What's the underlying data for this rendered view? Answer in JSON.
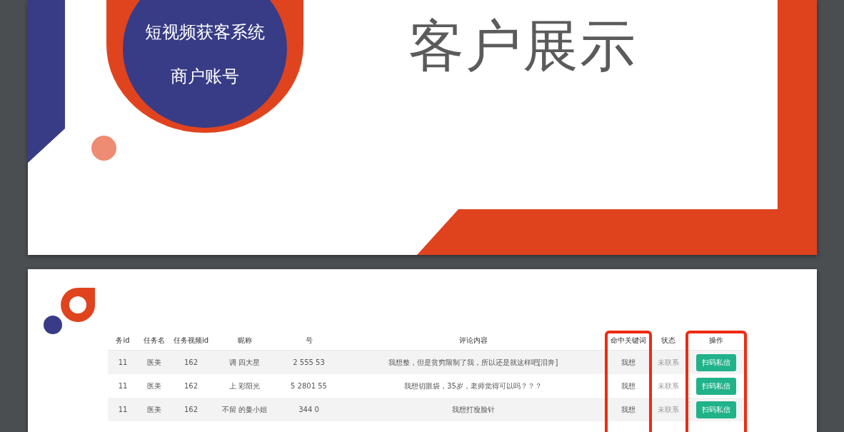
{
  "cover_slide": {
    "badge_lines": [
      "短视频获客系统",
      "商户账号"
    ],
    "title_lines": [
      "客户展示"
    ]
  },
  "table_slide": {
    "columns": [
      {
        "label": "务id",
        "highlighted": false
      },
      {
        "label": "任务名",
        "highlighted": false
      },
      {
        "label": "任务视频id",
        "highlighted": false
      },
      {
        "label": "昵称",
        "highlighted": false
      },
      {
        "label": "号",
        "highlighted": false
      },
      {
        "label": "评论内容",
        "highlighted": false
      },
      {
        "label": "命中关键词",
        "highlighted": true
      },
      {
        "label": "状态",
        "highlighted": false
      },
      {
        "label": "操作",
        "highlighted": true
      }
    ],
    "rows": [
      {
        "cells": [
          "11",
          "医美",
          "162",
          "调  四大星",
          "2  555  53",
          "我想整，但是贫穷限制了我，所以还是就这样吧[泪奔]",
          "我想",
          "未联系"
        ],
        "button": "扫码私信"
      },
      {
        "cells": [
          "11",
          "医美",
          "162",
          "上  彩阳光",
          "5  2801  55",
          "我想切眼袋，35岁，老师觉得可以吗？？？",
          "我想",
          "未联系"
        ],
        "button": "扫码私信"
      },
      {
        "cells": [
          "11",
          "医美",
          "162",
          "不留  的曼小姐",
          "344  0",
          "我想打瘦脸针",
          "我想",
          "未联系"
        ],
        "button": "扫码私信"
      }
    ]
  }
}
